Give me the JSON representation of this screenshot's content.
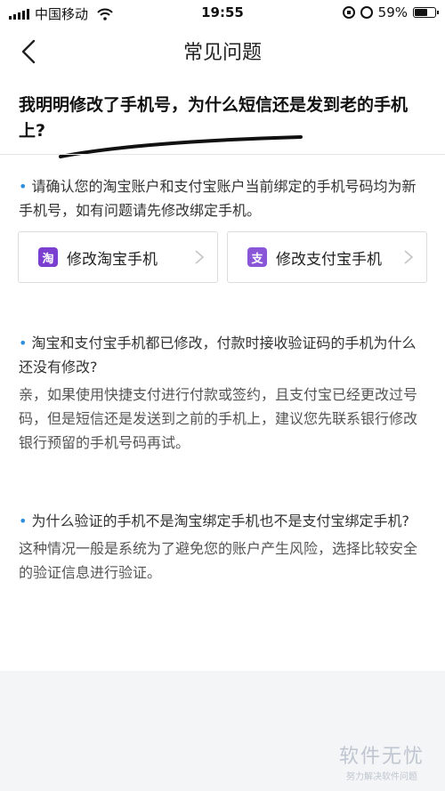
{
  "status_bar": {
    "carrier": "中国移动",
    "time": "19:55",
    "battery": "59%",
    "battery_level": 0.59
  },
  "nav": {
    "title": "常见问题"
  },
  "question": {
    "title": "我明明修改了手机号，为什么短信还是发到老的手机上?"
  },
  "faq": [
    {
      "q": "请确认您的淘宝账户和支付宝账户当前绑定的手机号码均为新手机号，如有问题请先修改绑定手机。",
      "a": ""
    },
    {
      "q": "淘宝和支付宝手机都已修改，付款时接收验证码的手机为什么还没有修改?",
      "a": "亲，如果使用快捷支付进行付款或签约，且支付宝已经更改过号码，但是短信还是发送到之前的手机上，建议您先联系银行修改银行预留的手机号码再试。"
    },
    {
      "q": "为什么验证的手机不是淘宝绑定手机也不是支付宝绑定手机?",
      "a": "这种情况一般是系统为了避免您的账户产生风险，选择比较安全的验证信息进行验证。"
    }
  ],
  "buttons": {
    "taobao": {
      "label": "修改淘宝手机",
      "icon_char": "淘",
      "icon_color": "#7a3fd0"
    },
    "alipay": {
      "label": "修改支付宝手机",
      "icon_char": "支",
      "icon_color": "#8a56d8"
    }
  },
  "watermark": {
    "main": "软件无忧",
    "sub": "努力解决软件问题"
  },
  "icons": {
    "back": "chevron-left-icon",
    "button_arrow": "chevron-right-icon"
  }
}
